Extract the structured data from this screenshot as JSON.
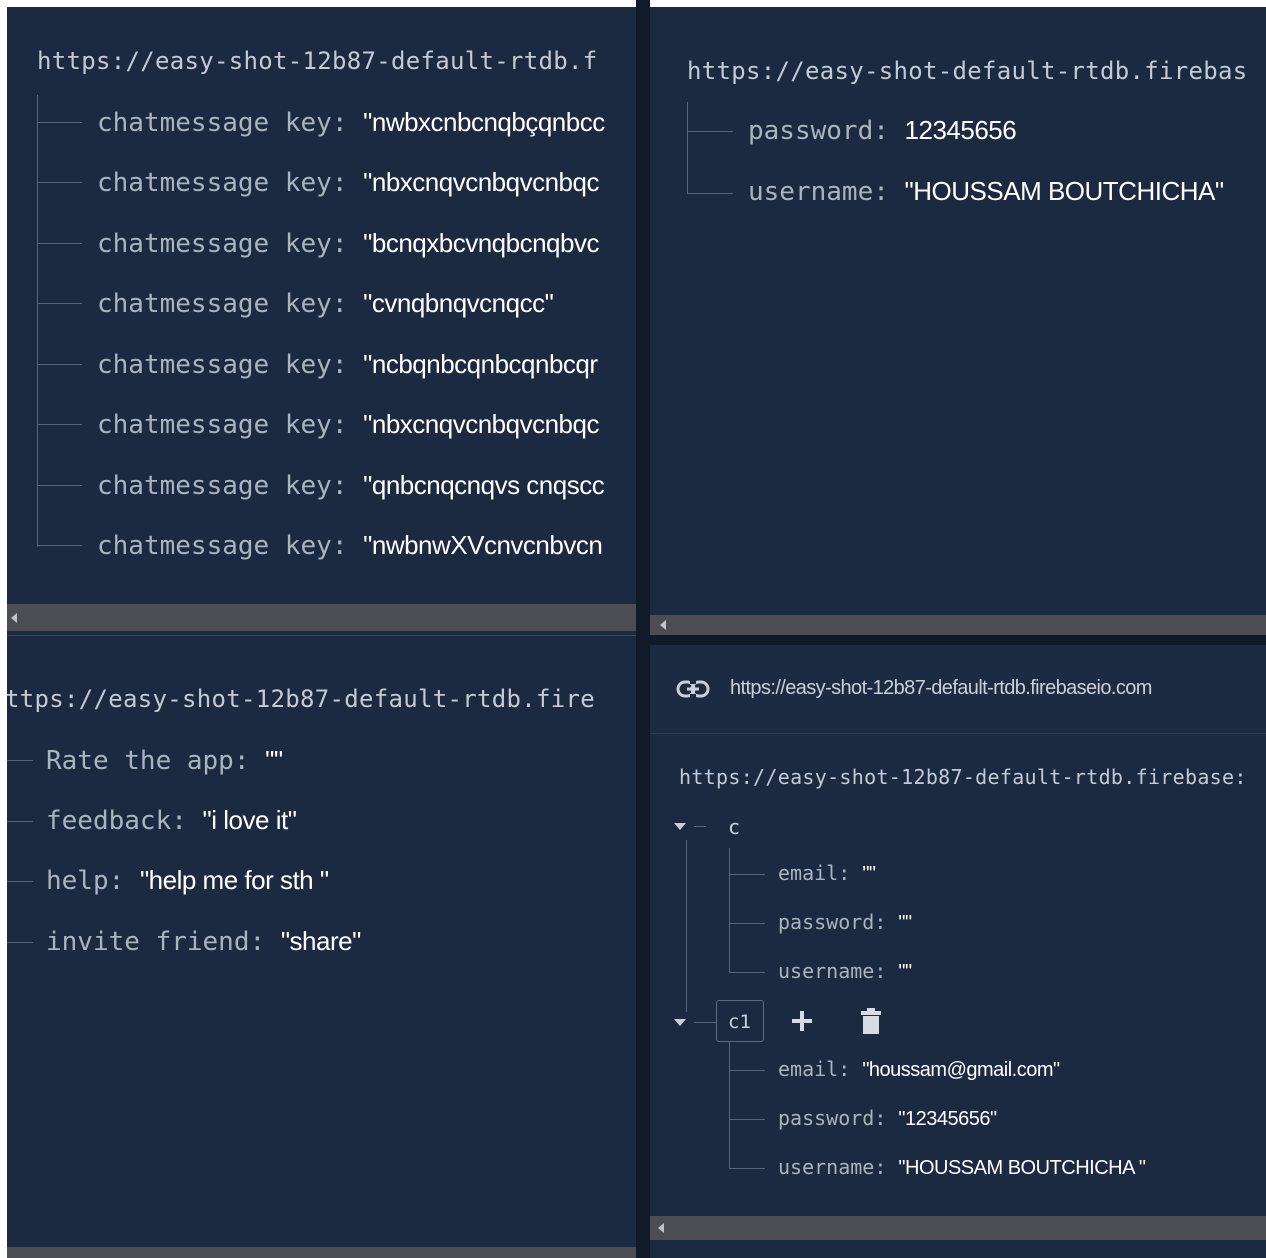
{
  "panel_top_left": {
    "url": "https://easy-shot-12b87-default-rtdb.f",
    "rows": [
      {
        "key": "chatmessage key",
        "value": "\"nwbxcnbcnqbçqnbcc"
      },
      {
        "key": "chatmessage key",
        "value": "\"nbxcnqvcnbqvcnbqc"
      },
      {
        "key": "chatmessage key",
        "value": "\"bcnqxbcvnqbcnqbvc"
      },
      {
        "key": "chatmessage key",
        "value": "\"cvnqbnqvcnqcc\""
      },
      {
        "key": "chatmessage key",
        "value": "\"ncbqnbcqnbcqnbcqr"
      },
      {
        "key": "chatmessage key",
        "value": "\"nbxcnqvcnbqvcnbqc"
      },
      {
        "key": "chatmessage key",
        "value": "\"qnbcnqcnqvs cnqscc"
      },
      {
        "key": "chatmessage key",
        "value": "\"nwbnwXVcnvcnbvcn"
      }
    ]
  },
  "panel_top_right": {
    "url": "https://easy-shot-default-rtdb.firebas",
    "rows": [
      {
        "key": "password",
        "value": "12345656"
      },
      {
        "key": "username",
        "value": "\"HOUSSAM BOUTCHICHA\""
      }
    ]
  },
  "panel_bottom_left": {
    "url": "ttps://easy-shot-12b87-default-rtdb.fire",
    "rows": [
      {
        "key": "Rate the app",
        "value": "\"\""
      },
      {
        "key": "feedback",
        "value": "\"i love it\""
      },
      {
        "key": "help",
        "value": "\"help me for sth \""
      },
      {
        "key": "invite friend",
        "value": "\"share\""
      }
    ]
  },
  "panel_bottom_right": {
    "header_url": "https://easy-shot-12b87-default-rtdb.firebaseio.com",
    "url": "https://easy-shot-12b87-default-rtdb.firebase:",
    "node_c": {
      "name": "c",
      "rows": [
        {
          "key": "email",
          "value": "\"\""
        },
        {
          "key": "password",
          "value": "\"\""
        },
        {
          "key": "username",
          "value": "\"\""
        }
      ]
    },
    "node_c1": {
      "name": "c1",
      "rows": [
        {
          "key": "email",
          "value": "\"houssam@gmail.com\""
        },
        {
          "key": "password",
          "value": "\"12345656\""
        },
        {
          "key": "username",
          "value": "\"HOUSSAM BOUTCHICHA \""
        }
      ]
    },
    "icons": [
      "link-icon",
      "plus-icon",
      "trash-icon",
      "expand-triangle-icon"
    ]
  },
  "colors": {
    "panel_bg": "#1b2a40",
    "key_text": "#aab3c0",
    "value_text": "#ffffff",
    "tree_lines": "#586579",
    "scrollbar": "#4c4d52"
  }
}
